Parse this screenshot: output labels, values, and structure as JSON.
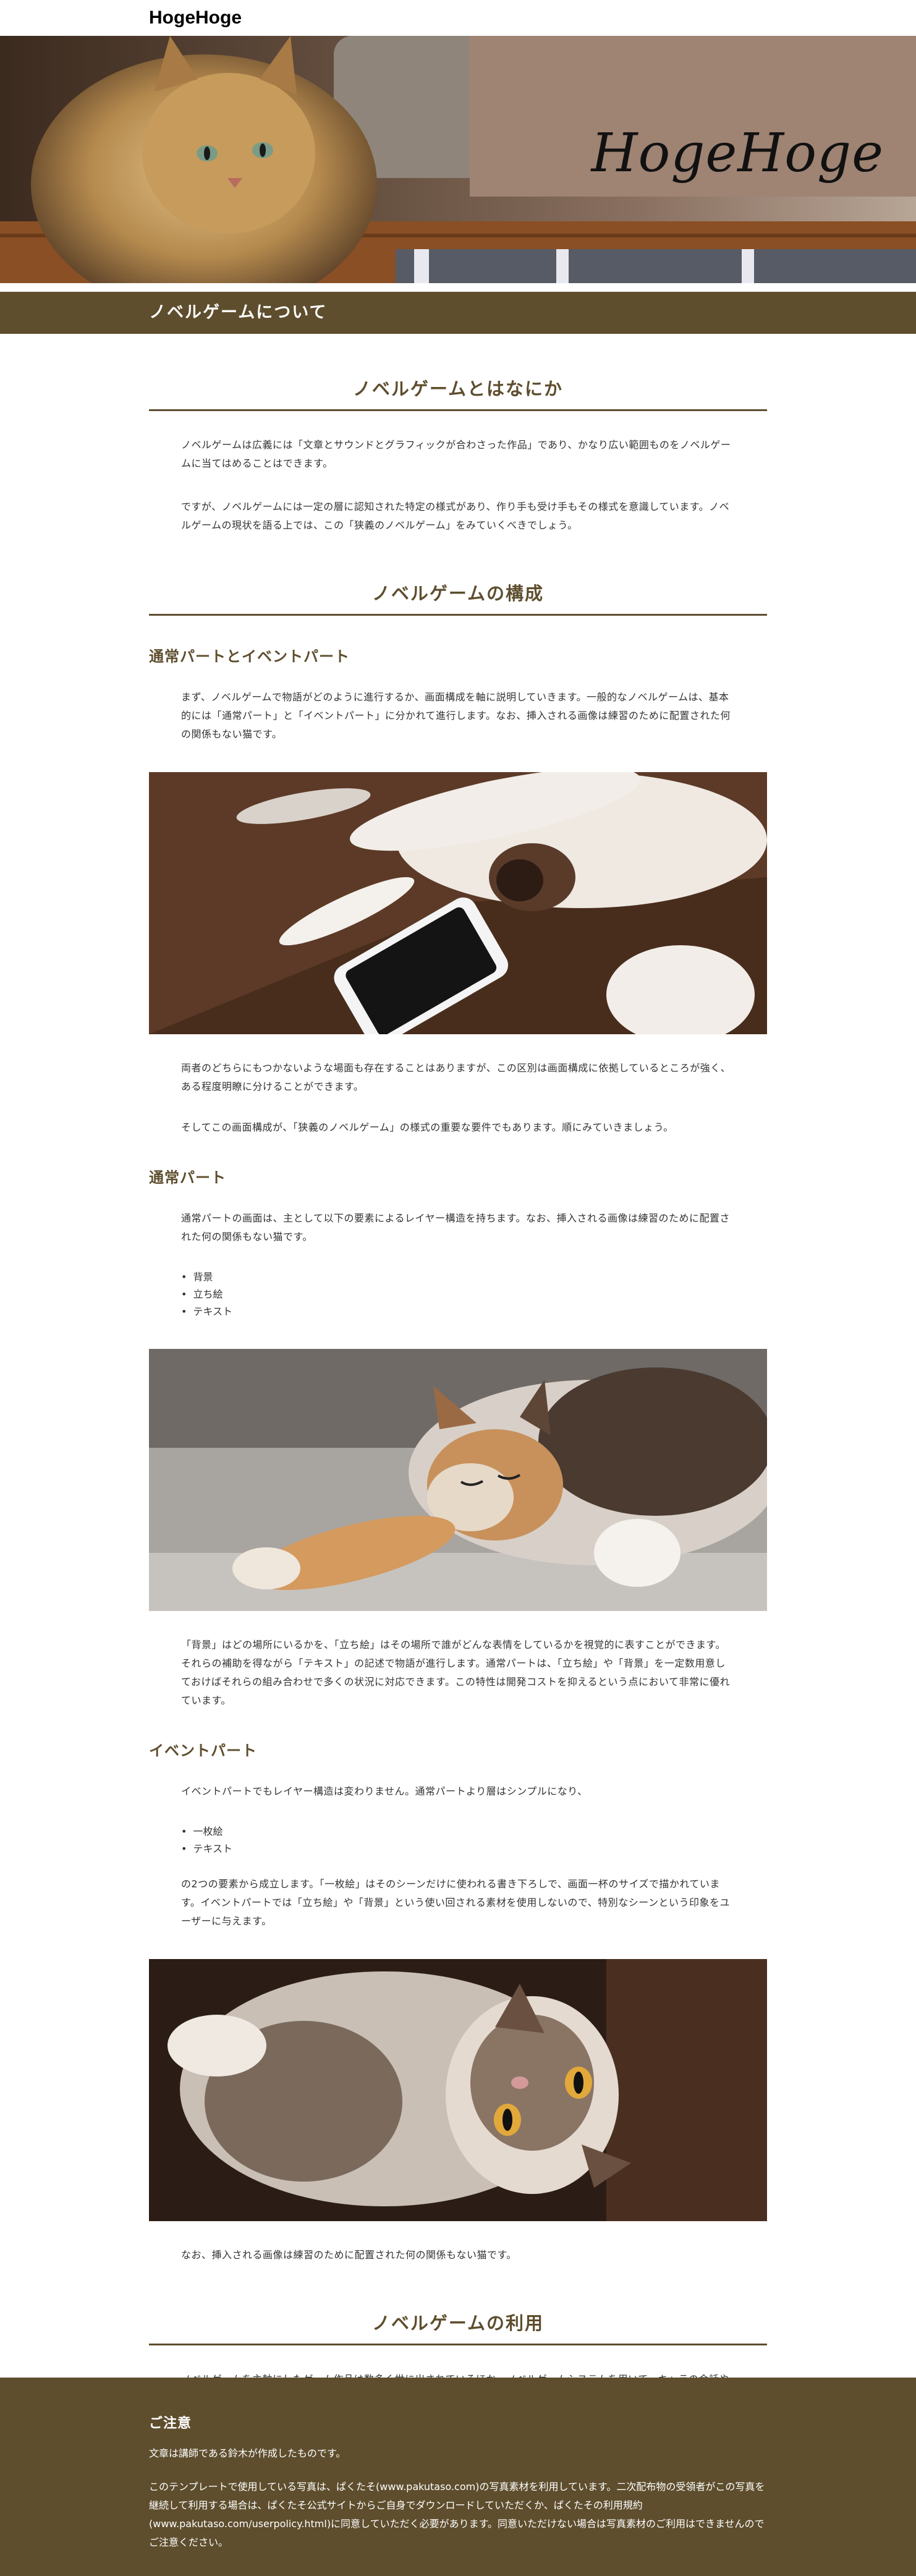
{
  "site": {
    "logo": "HogeHoge"
  },
  "hero": {
    "title": "HogeHoge"
  },
  "page": {
    "title": "ノベルゲームについて"
  },
  "sections": {
    "s1": {
      "title": "ノベルゲームとはなにか",
      "p1": "ノベルゲームは広義には「文章とサウンドとグラフィックが合わさった作品」であり、かなり広い範囲ものをノベルゲームに当てはめることはできます。",
      "p2": "ですが、ノベルゲームには一定の層に認知された特定の様式があり、作り手も受け手もその様式を意識しています。ノベルゲームの現状を語る上では、この「狭義のノベルゲーム」をみていくべきでしょう。"
    },
    "s2": {
      "title": "ノベルゲームの構成",
      "sub1": "通常パートとイベントパート",
      "p1": "まず、ノベルゲームで物語がどのように進行するか、画面構成を軸に説明していきます。一般的なノベルゲームは、基本的には「通常パート」と「イベントパート」に分かれて進行します。なお、挿入される画像は練習のために配置された何の関係もない猫です。",
      "p2": "両者のどちらにもつかないような場面も存在することはありますが、この区別は画面構成に依拠しているところが強く、ある程度明瞭に分けることができます。",
      "p3": "そしてこの画面構成が、「狭義のノベルゲーム」の様式の重要な要件でもあります。順にみていきましょう。",
      "sub2": "通常パート",
      "p4": "通常パートの画面は、主として以下の要素によるレイヤー構造を持ちます。なお、挿入される画像は練習のために配置された何の関係もない猫です。",
      "list1": [
        "背景",
        "立ち絵",
        "テキスト"
      ],
      "p5": "「背景」はどの場所にいるかを、「立ち絵」はその場所で誰がどんな表情をしているかを視覚的に表すことができます。それらの補助を得ながら「テキスト」の記述で物語が進行します。通常パートは、「立ち絵」や「背景」を一定数用意しておけばそれらの組み合わせで多くの状況に対応できます。この特性は開発コストを抑えるという点において非常に優れています。",
      "sub3": "イベントパート",
      "p6": "イベントパートでもレイヤー構造は変わりません。通常パートより層はシンプルになり、",
      "list2": [
        "一枚絵",
        "テキスト"
      ],
      "p7": "の2つの要素から成立します。「一枚絵」はそのシーンだけに使われる書き下ろしで、画面一杯のサイズで描かれています。イベントパートでは「立ち絵」や「背景」という使い回される素材を使用しないので、特別なシーンという印象をユーザーに与えます。",
      "p8": "なお、挿入される画像は練習のために配置された何の関係もない猫です。"
    },
    "s3": {
      "title": "ノベルゲームの利用",
      "p1": "ノベルゲームを主軸にしたゲーム作品は数多く世に出されているほか、ノベルゲームシステムを用いて、キャラの会話やストーリーテリングを行うケースは数多く存在しています。"
    }
  },
  "footer": {
    "heading": "ご注意",
    "line1": "文章は講師である鈴木が作成したものです。",
    "line2": "このテンプレートで使用している写真は、ぱくたそ(www.pakutaso.com)の写真素材を利用しています。二次配布物の受領者がこの写真を継続して利用する場合は、ぱくたそ公式サイトからご自身でダウンロードしていただくか、ぱくたその利用規約(www.pakutaso.com/userpolicy.html)に同意していただく必要があります。同意いただけない場合は写真素材のご利用はできませんのでご注意ください。"
  },
  "colors": {
    "accent": "#5e4e2e",
    "footer_bg": "#5e4e2e",
    "text": "#333333"
  }
}
